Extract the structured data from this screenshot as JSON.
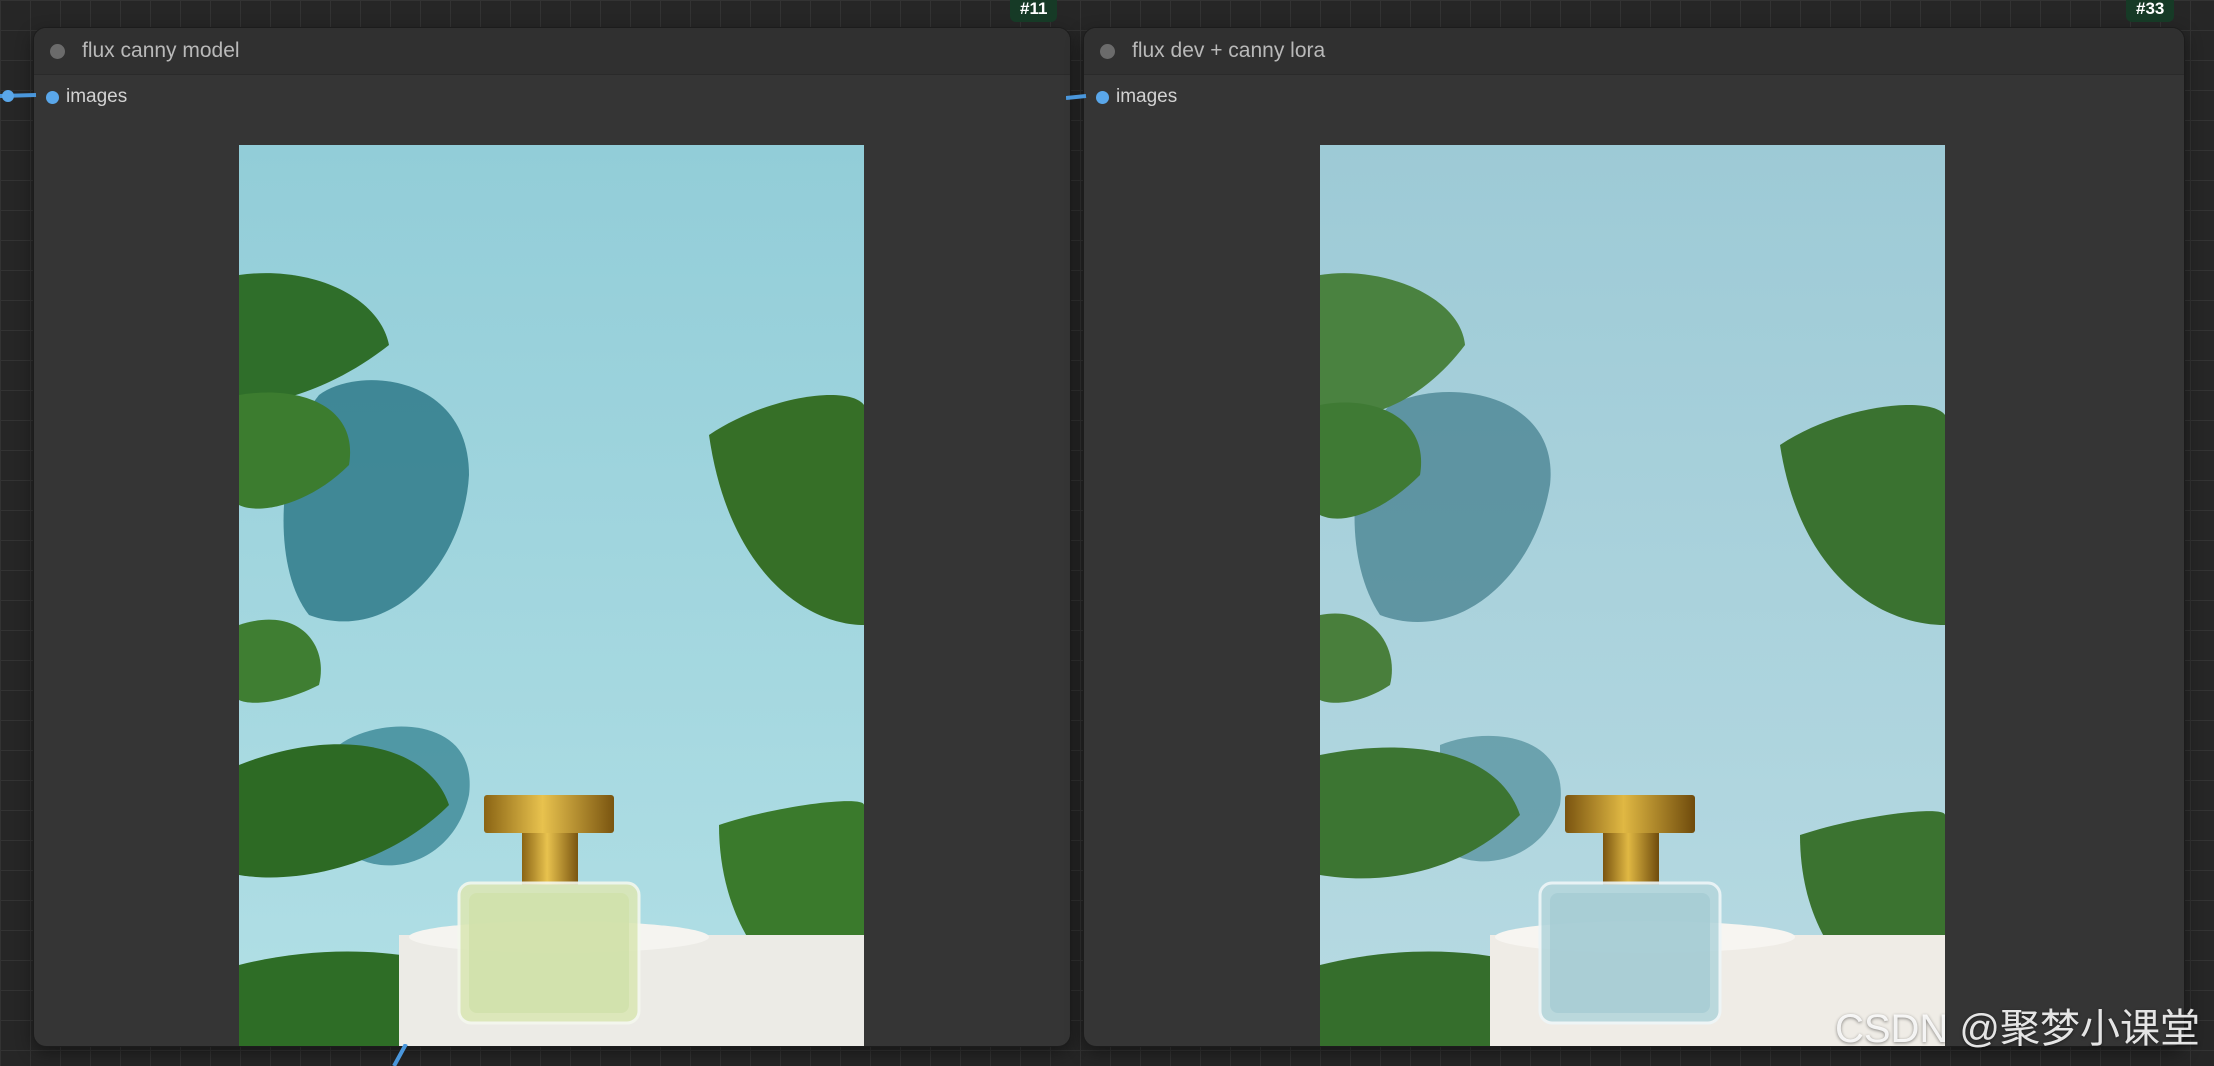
{
  "nodes": [
    {
      "id": "#11",
      "title": "flux canny model",
      "slot_label": "images"
    },
    {
      "id": "#33",
      "title": "flux dev + canny lora",
      "slot_label": "images"
    }
  ],
  "watermark": "CSDN @聚梦小课堂",
  "icons": {
    "collapse": "circle-dot-icon",
    "slot": "input-slot-dot-icon"
  },
  "colors": {
    "canvas": "#262626",
    "node": "#353535",
    "slot": "#5aa7ea",
    "id_badge": "#163a26"
  }
}
